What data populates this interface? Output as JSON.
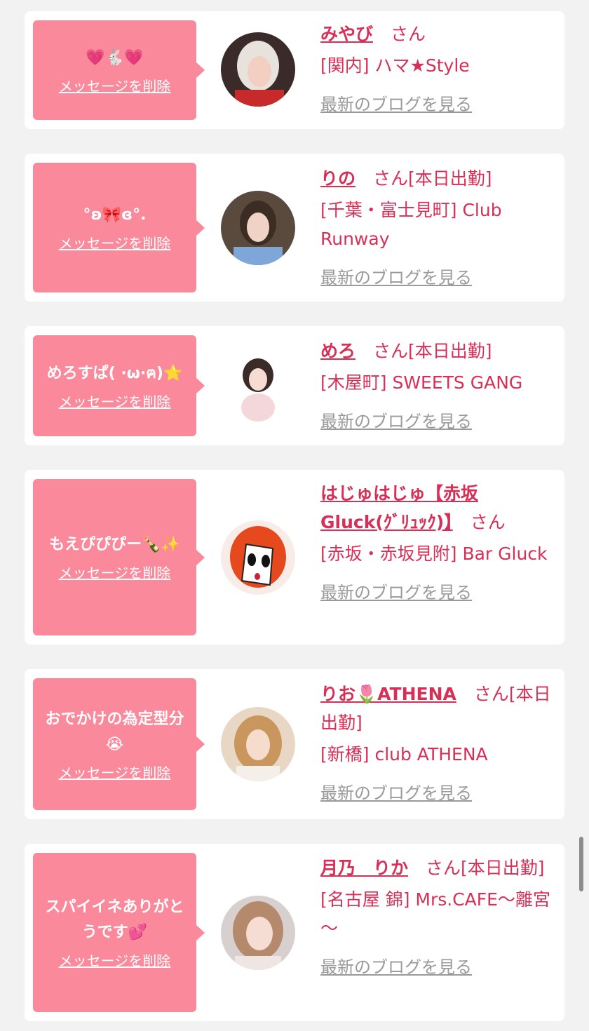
{
  "cards": [
    {
      "message": "💗🐇💗",
      "delete_label": "メッセージを削除",
      "name": "みやび",
      "suffix": "　さん",
      "location": "[関内] ハマ★Style",
      "blog_label": "最新のブログを見る"
    },
    {
      "message": "°ʚ🎀ɞ°.",
      "delete_label": "メッセージを削除",
      "name": "りの",
      "suffix": "　さん[本日出勤]",
      "location": "[千葉・富士見町] Club Runway",
      "blog_label": "最新のブログを見る"
    },
    {
      "message": "めろすぱ( ·ω·ฅ)⭐",
      "delete_label": "メッセージを削除",
      "name": "めろ",
      "suffix": "　さん[本日出勤]",
      "location": "[木屋町] SWEETS GANG",
      "blog_label": "最新のブログを見る"
    },
    {
      "message": "もえぴぴぴー🍾✨",
      "delete_label": "メッセージを削除",
      "name": "はじゅはじゅ【赤坂Gluck(ｸﾞﾘｭｯｸ)】",
      "suffix": "　さん",
      "location": "[赤坂・赤坂見附] Bar Gluck",
      "blog_label": "最新のブログを見る"
    },
    {
      "message": "おでかけの為定型分😭",
      "delete_label": "メッセージを削除",
      "name": "りお🌷ATHENA",
      "suffix": "　さん[本日出勤]",
      "location": "[新橋] club ATHENA",
      "blog_label": "最新のブログを見る"
    },
    {
      "message": "スパイイネありがとうです💕",
      "delete_label": "メッセージを削除",
      "name": "月乃　りか",
      "suffix": "　さん[本日出勤]",
      "location": "[名古屋 錦] Mrs.CAFE～離宮～",
      "blog_label": "最新のブログを見る"
    }
  ],
  "colors": {
    "bubble": "#f9899b",
    "name": "#d82f57",
    "blog_link": "#9a9a9a",
    "card": "#ffffff",
    "background": "#f2f2f2"
  }
}
